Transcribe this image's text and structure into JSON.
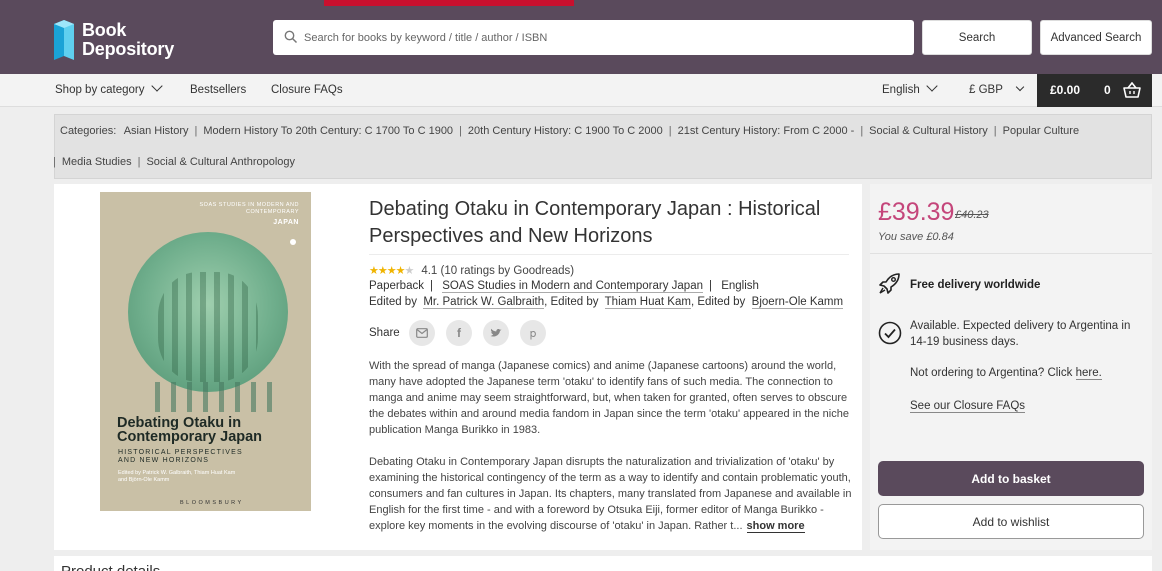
{
  "header": {
    "brand_line1": "Book",
    "brand_line2": "Depository",
    "search_placeholder": "Search for books by keyword / title / author / ISBN",
    "search_button": "Search",
    "advanced_search_button": "Advanced Search",
    "colors": {
      "header_bg": "#5a4a5c",
      "accent": "#c8102e"
    }
  },
  "nav": {
    "shop_by_category": "Shop by category",
    "bestsellers": "Bestsellers",
    "closure_faqs": "Closure FAQs",
    "language": "English",
    "currency": "£ GBP",
    "basket_total": "£0.00",
    "basket_count": "0"
  },
  "categories": {
    "label": "Categories:",
    "items": [
      "Asian History",
      "Modern History To 20th Century: C 1700 To C 1900",
      "20th Century History: C 1900 To C 2000",
      "21st Century History: From C 2000 -",
      "Social & Cultural History",
      "Popular Culture",
      "Media Studies",
      "Social & Cultural Anthropology"
    ]
  },
  "cover": {
    "series": "SOAS STUDIES IN MODERN AND CONTEMPORARY",
    "series_country": "JAPAN",
    "title_line1": "Debating Otaku in",
    "title_line2": "Contemporary Japan",
    "subtitle_line1": "HISTORICAL PERSPECTIVES",
    "subtitle_line2": "AND NEW HORIZONS",
    "editors_line1": "Edited by Patrick W. Galbraith, Thiam Huat Kam",
    "editors_line2": "and Björn-Ole Kamm",
    "publisher": "BLOOMSBURY"
  },
  "product": {
    "title": "Debating Otaku in Contemporary Japan : Historical Perspectives and New Horizons",
    "rating": 4.1,
    "rating_text": "4.1 (10 ratings by Goodreads)",
    "format": "Paperback",
    "series": "SOAS Studies in Modern and Contemporary Japan",
    "language": "English",
    "edited_by_label": "Edited by",
    "editor1": "Mr. Patrick W. Galbraith",
    "edited_by_label2": ", Edited by",
    "editor2": "Thiam Huat Kam",
    "edited_by_label3": ", Edited by",
    "editor3": "Bjoern-Ole Kamm",
    "share_label": "Share",
    "share_icons": [
      "email-icon",
      "facebook-icon",
      "twitter-icon",
      "pinterest-icon"
    ],
    "description_p1": "With the spread of manga (Japanese comics) and anime (Japanese cartoons) around the world, many have adopted the Japanese term 'otaku' to identify fans of such media. The connection to manga and anime may seem straightforward, but, when taken for granted, often serves to obscure the debates within and around media fandom in Japan since the term 'otaku' appeared in the niche publication Manga Burikko in 1983.",
    "description_p2": "Debating Otaku in Contemporary Japan disrupts the naturalization and trivialization of 'otaku' by examining the historical contingency of the term as a way to identify and contain problematic youth, consumers and fan cultures in Japan. Its chapters, many translated from Japanese and available in English for the first time - and with a foreword by Otsuka Eiji, former editor of Manga Burikko - explore key moments in the evolving discourse of 'otaku' in Japan. Rather t...",
    "show_more": "show more"
  },
  "purchase": {
    "price": "£39.39",
    "old_price": "£40.23",
    "you_save": "You save £0.84",
    "free_delivery": "Free delivery worldwide",
    "availability": "Available. Expected delivery to Argentina in 14-19 business days.",
    "not_ordering": "Not ordering to Argentina? Click",
    "here_link": "here.",
    "see_closure": "See our Closure FAQs",
    "add_to_basket": "Add to basket",
    "add_to_wishlist": "Add to wishlist",
    "colors": {
      "price": "#c4457a",
      "basket_button": "#5a4a5c"
    }
  },
  "product_details_heading": "Product details"
}
